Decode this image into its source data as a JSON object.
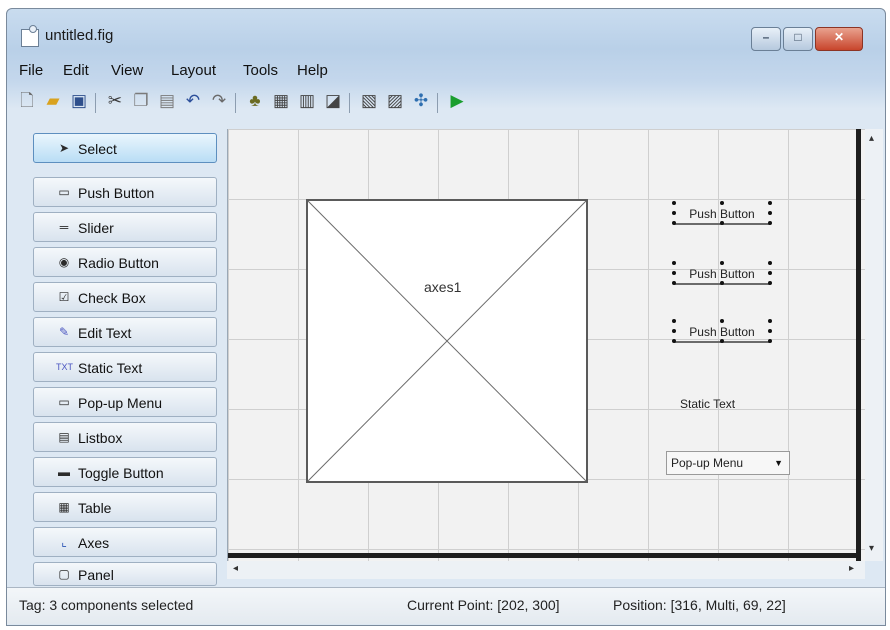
{
  "window": {
    "title": "untitled.fig"
  },
  "menubar": {
    "items": [
      "File",
      "Edit",
      "View",
      "Layout",
      "Tools",
      "Help"
    ]
  },
  "toolbar": {
    "icons": [
      "new-file-icon",
      "open-folder-icon",
      "save-icon",
      "cut-icon",
      "copy-icon",
      "paste-icon",
      "undo-icon",
      "redo-icon",
      "align-objects-icon",
      "menu-editor-icon",
      "tab-order-icon",
      "toolbar-editor-icon",
      "editor-icon",
      "property-inspector-icon",
      "object-browser-icon",
      "run-icon"
    ]
  },
  "palette": {
    "items": [
      {
        "label": "Select",
        "icon": "arrow-cursor-icon",
        "selected": true
      },
      {
        "label": "Push Button",
        "icon": "push-button-icon"
      },
      {
        "label": "Slider",
        "icon": "slider-icon"
      },
      {
        "label": "Radio Button",
        "icon": "radio-button-icon"
      },
      {
        "label": "Check Box",
        "icon": "check-box-icon"
      },
      {
        "label": "Edit Text",
        "icon": "edit-text-icon"
      },
      {
        "label": "Static Text",
        "icon": "static-text-icon"
      },
      {
        "label": "Pop-up Menu",
        "icon": "popup-menu-icon"
      },
      {
        "label": "Listbox",
        "icon": "listbox-icon"
      },
      {
        "label": "Toggle Button",
        "icon": "toggle-button-icon"
      },
      {
        "label": "Table",
        "icon": "table-icon"
      },
      {
        "label": "Axes",
        "icon": "axes-icon"
      },
      {
        "label": "Panel",
        "icon": "panel-icon"
      }
    ]
  },
  "canvas": {
    "axes_label": "axes1",
    "push_buttons": [
      "Push Button",
      "Push Button",
      "Push Button"
    ],
    "static_text": "Static Text",
    "popup_menu": "Pop-up Menu"
  },
  "status": {
    "tag": "Tag: 3 components selected",
    "current_point": "Current Point:  [202, 300]",
    "position": "Position: [316, Multi, 69, 22]"
  }
}
